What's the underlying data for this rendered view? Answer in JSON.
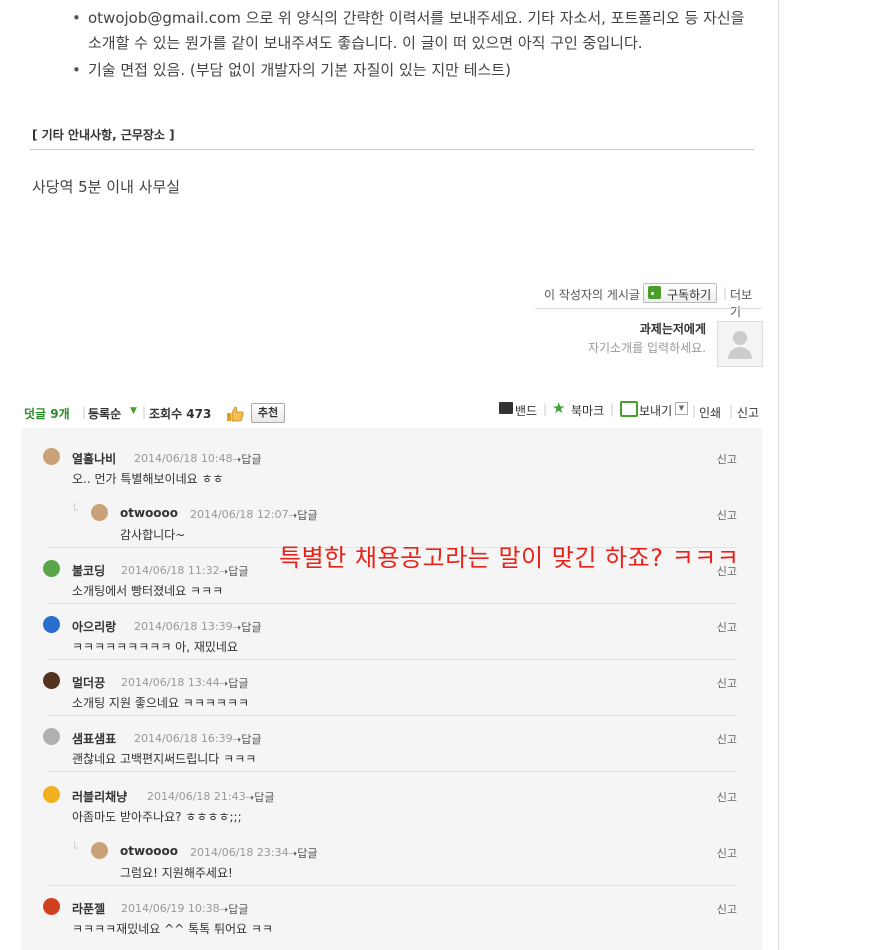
{
  "post": {
    "bullets": [
      "otwojob@gmail.com 으로 위 양식의 간략한 이력서를 보내주세요. 기타 자소서, 포트폴리오 등 자신을 소개할 수 있는 뭔가를 같이 보내주셔도 좋습니다. 이 글이 떠 있으면 아직 구인 중입니다.",
      "기술 면접 있음. (부담 없이 개발자의 기본 자질이 있는 지만 테스트)"
    ],
    "section_title": "[ 기타 안내사항, 근무장소 ]",
    "location": "사당역 5분 이내 사무실"
  },
  "author": {
    "posts_label": "이 작성자의 게시글",
    "subscribe_label": "구독하기",
    "more_label": "더보기",
    "name": "과제는저에게",
    "intro": "자기소개를 입력하세요."
  },
  "comment_bar": {
    "comments_label": "덧글",
    "comments_count": "9개",
    "order_label": "등록순",
    "views_label": "조회수 473",
    "recommend_label": "추천",
    "band_label": "밴드",
    "bookmark_label": "북마크",
    "send_label": "보내기",
    "print_label": "인쇄",
    "report_label": "신고"
  },
  "reply_label": "답글",
  "report_label": "신고",
  "comments": [
    {
      "nick": "열흘나비",
      "date": "2014/06/18 10:48",
      "body": "오.. 먼가 특별해보이네요 ㅎㅎ",
      "is_reply": false,
      "avatar_color": "#c9a27a"
    },
    {
      "nick": "otwoooo",
      "date": "2014/06/18 12:07",
      "body": "감사합니다~",
      "is_reply": true,
      "avatar_color": "#c9a27a"
    },
    {
      "nick": "불코딩",
      "date": "2014/06/18 11:32",
      "body": "소개팅에서 빵터졌네요 ㅋㅋㅋ",
      "is_reply": false,
      "avatar_color": "#5aa548"
    },
    {
      "nick": "아으리랑",
      "date": "2014/06/18 13:39",
      "body": "ㅋㅋㅋㅋㅋㅋㅋㅋㅋ 아, 재밌네요",
      "is_reply": false,
      "avatar_color": "#2a6fd0"
    },
    {
      "nick": "멀더끙",
      "date": "2014/06/18 13:44",
      "body": "소개팅 지원 좋으네요 ㅋㅋㅋㅋㅋㅋ",
      "is_reply": false,
      "avatar_color": "#553322"
    },
    {
      "nick": "샘표샘표",
      "date": "2014/06/18 16:39",
      "body": "괜찮네요 고백편지써드립니다 ㅋㅋㅋ",
      "is_reply": false,
      "avatar_color": "#b0b0b0"
    },
    {
      "nick": "러블리채냥",
      "date": "2014/06/18 21:43",
      "body": "아좀마도 받아주나요? ㅎㅎㅎㅎ;;;",
      "is_reply": false,
      "avatar_color": "#f0b020"
    },
    {
      "nick": "otwoooo",
      "date": "2014/06/18 23:34",
      "body": "그럼요! 지원해주세요!",
      "is_reply": true,
      "avatar_color": "#c9a27a"
    },
    {
      "nick": "라푼젤",
      "date": "2014/06/19 10:38",
      "body": "ㅋㅋㅋㅋ재밌네요 ^^ 톡톡 튀어요 ㅋㅋ",
      "is_reply": false,
      "avatar_color": "#d04020"
    }
  ],
  "overlay": "특별한 채용공고라는 말이 맞긴 하죠? ㅋㅋㅋ"
}
